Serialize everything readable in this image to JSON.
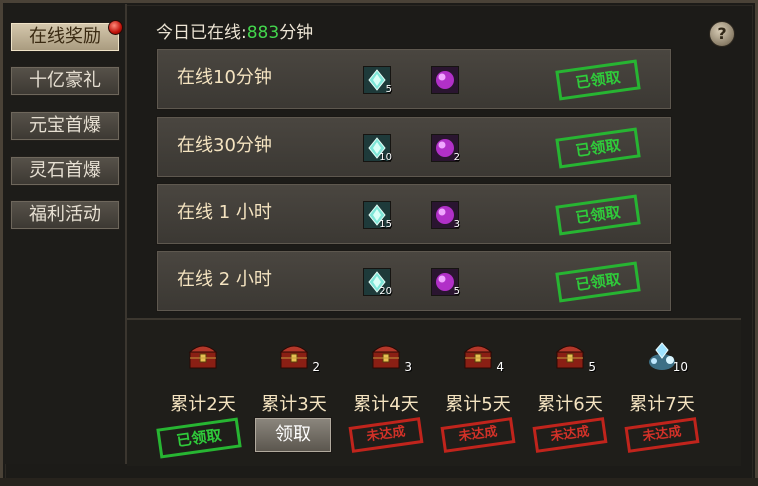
{
  "sidebar": {
    "items": [
      {
        "label": "在线奖励",
        "active": true,
        "has_badge": true
      },
      {
        "label": "十亿豪礼",
        "active": false
      },
      {
        "label": "元宝首爆",
        "active": false
      },
      {
        "label": "灵石首爆",
        "active": false
      },
      {
        "label": "福利活动",
        "active": false
      }
    ]
  },
  "header": {
    "online_prefix": "今日已在线:",
    "online_minutes": "883",
    "online_suffix": "分钟",
    "help_icon": "?"
  },
  "rewards": [
    {
      "label": "在线10分钟",
      "items": [
        {
          "icon": "crystal-icon",
          "count": "5"
        },
        {
          "icon": "purple-orb-icon",
          "count": ""
        }
      ],
      "status": "已领取"
    },
    {
      "label": "在线30分钟",
      "items": [
        {
          "icon": "crystal-icon",
          "count": "10"
        },
        {
          "icon": "purple-orb-icon",
          "count": "2"
        }
      ],
      "status": "已领取"
    },
    {
      "label": "在线 1 小时",
      "items": [
        {
          "icon": "crystal-icon",
          "count": "15"
        },
        {
          "icon": "purple-orb-icon",
          "count": "3"
        }
      ],
      "status": "已领取"
    },
    {
      "label": "在线 2 小时",
      "items": [
        {
          "icon": "crystal-icon",
          "count": "20"
        },
        {
          "icon": "purple-orb-icon",
          "count": "5"
        }
      ],
      "status": "已领取"
    }
  ],
  "cumulative": [
    {
      "label": "累计2天",
      "icon": "treasure-chest-icon",
      "count": "",
      "status": "已领取",
      "status_type": "claimed"
    },
    {
      "label": "累计3天",
      "icon": "treasure-chest-icon",
      "count": "2",
      "status": "领取",
      "status_type": "button"
    },
    {
      "label": "累计4天",
      "icon": "treasure-chest-icon",
      "count": "3",
      "status": "未达成",
      "status_type": "locked"
    },
    {
      "label": "累计5天",
      "icon": "treasure-chest-icon",
      "count": "4",
      "status": "未达成",
      "status_type": "locked"
    },
    {
      "label": "累计6天",
      "icon": "treasure-chest-icon",
      "count": "5",
      "status": "未达成",
      "status_type": "locked"
    },
    {
      "label": "累计7天",
      "icon": "gem-pile-icon",
      "count": "10",
      "status": "未达成",
      "status_type": "locked"
    }
  ],
  "colors": {
    "online_value": "#43d64d",
    "stamp_claimed": "#2fcb3a",
    "stamp_locked": "#d23128",
    "label_text": "#f4e3c0"
  }
}
